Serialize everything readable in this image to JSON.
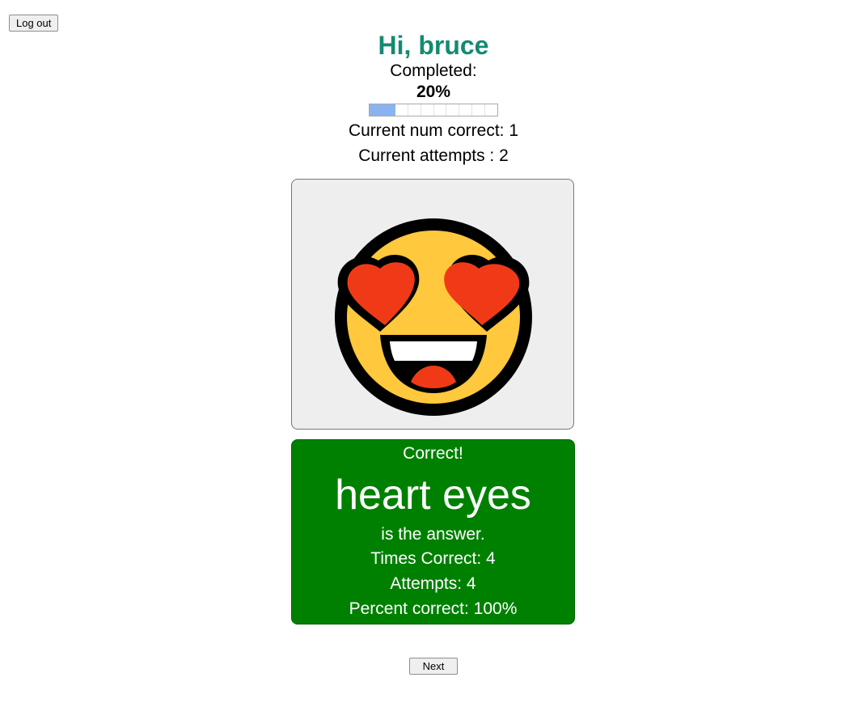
{
  "header": {
    "logout_label": "Log out",
    "greeting": "Hi, bruce",
    "completed_label": "Completed:",
    "completed_value": "20%",
    "progress_fraction": 0.2,
    "num_correct_text": "Current num correct: 1",
    "attempts_text": "Current attempts : 2"
  },
  "emoji": {
    "icon": "smiling-face-with-heart-eyes-icon"
  },
  "result": {
    "status": "Correct!",
    "answer": "heart eyes",
    "suffix": "is the answer.",
    "times_correct": "Times Correct: 4",
    "attempts": "Attempts: 4",
    "percent_correct": "Percent correct: 100%"
  },
  "actions": {
    "next_label": "Next"
  },
  "colors": {
    "greeting": "#158a72",
    "result_background": "#008000",
    "progress_fill": "#8ab4f0",
    "emoji_face": "#ffc83d",
    "emoji_hearts": "#f03a17"
  }
}
